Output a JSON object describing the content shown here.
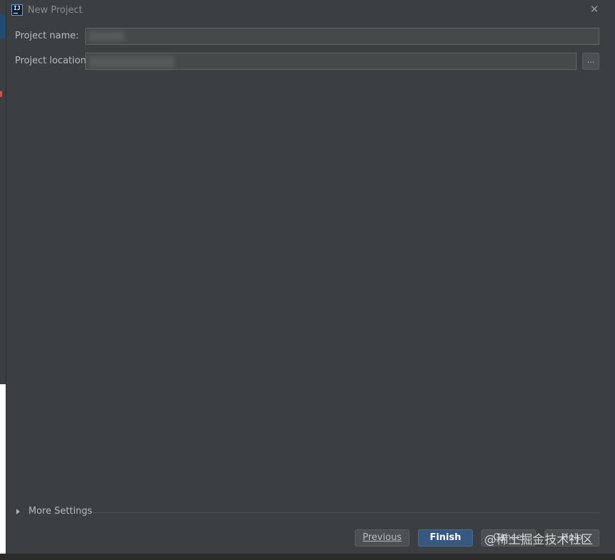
{
  "dialog": {
    "title": "New Project",
    "close_symbol": "✕",
    "app_logo_text": "IJ"
  },
  "form": {
    "project_name_label": "Project name:",
    "project_name_value": "",
    "project_location_label": "Project location:",
    "project_location_value": "",
    "browse_label": "..."
  },
  "more_settings": {
    "label": "More Settings",
    "expanded": false
  },
  "footer": {
    "previous_label": "Previous",
    "finish_label": "Finish",
    "cancel_label": "Cancel",
    "help_label": "Help"
  },
  "watermark": {
    "text": "@稀土掘金技术社区"
  },
  "colors": {
    "dialog_bg": "#3c3f41",
    "field_bg": "#45494a",
    "primary_button": "#365880",
    "text": "#bbbbbb"
  },
  "icons": {
    "app": "intellij-logo-icon",
    "close": "close-icon",
    "expand": "triangle-right-icon"
  }
}
